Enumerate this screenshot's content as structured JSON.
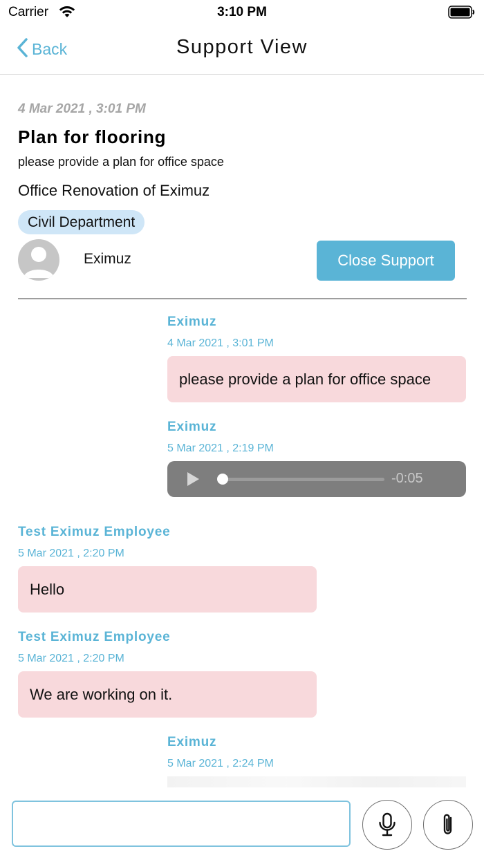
{
  "status_bar": {
    "carrier": "Carrier",
    "time": "3:10 PM",
    "icons": [
      "wifi-icon",
      "battery-icon"
    ]
  },
  "nav": {
    "back_label": "Back",
    "title": "Support View",
    "accent_color": "#5ab4d6"
  },
  "ticket": {
    "date": "4 Mar 2021 , 3:01 PM",
    "title": "Plan for flooring",
    "description": "please provide a plan for office space",
    "project": "Office Renovation of Eximuz",
    "department": "Civil Department",
    "owner": "Eximuz",
    "close_button": "Close Support"
  },
  "messages": [
    {
      "sender": "Eximuz",
      "time": "4 Mar 2021 , 3:01 PM",
      "side": "right",
      "type": "text",
      "text": "please provide a plan for office space"
    },
    {
      "sender": "Eximuz",
      "time": "5 Mar 2021 , 2:19 PM",
      "side": "right",
      "type": "audio",
      "remaining": "-0:05",
      "progress": 0.0
    },
    {
      "sender": "Test Eximuz Employee",
      "time": "5 Mar 2021 , 2:20 PM",
      "side": "left",
      "type": "text",
      "text": "Hello"
    },
    {
      "sender": "Test Eximuz Employee",
      "time": "5 Mar 2021 , 2:20 PM",
      "side": "left",
      "type": "text",
      "text": "We are working on it."
    },
    {
      "sender": "Eximuz",
      "time": "5 Mar 2021 , 2:24 PM",
      "side": "right",
      "type": "partial"
    }
  ],
  "input": {
    "placeholder": "",
    "value": "",
    "buttons": [
      "mic-icon",
      "paperclip-icon"
    ]
  },
  "colors": {
    "bubble": "#f8d9dc",
    "badge": "#cfe6f7",
    "audio_bg": "#7e7e7e"
  }
}
